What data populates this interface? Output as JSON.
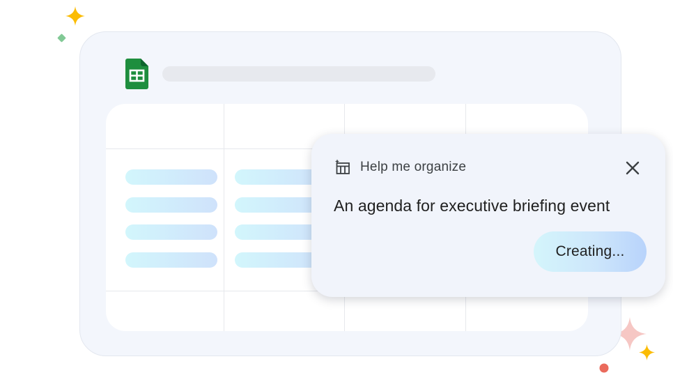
{
  "app": {
    "icon": "google-sheets-icon"
  },
  "popup": {
    "icon": "table-organize-icon",
    "title": "Help me organize",
    "prompt": "An agenda for executive briefing event",
    "close_icon": "close-icon",
    "button_label": "Creating..."
  },
  "colors": {
    "sheets_green": "#1e8e3e",
    "sparkle_yellow": "#fbbc04",
    "sparkle_green": "#81c995",
    "sparkle_pink": "#f6c7c4",
    "dot_red": "#ea6a5c"
  }
}
